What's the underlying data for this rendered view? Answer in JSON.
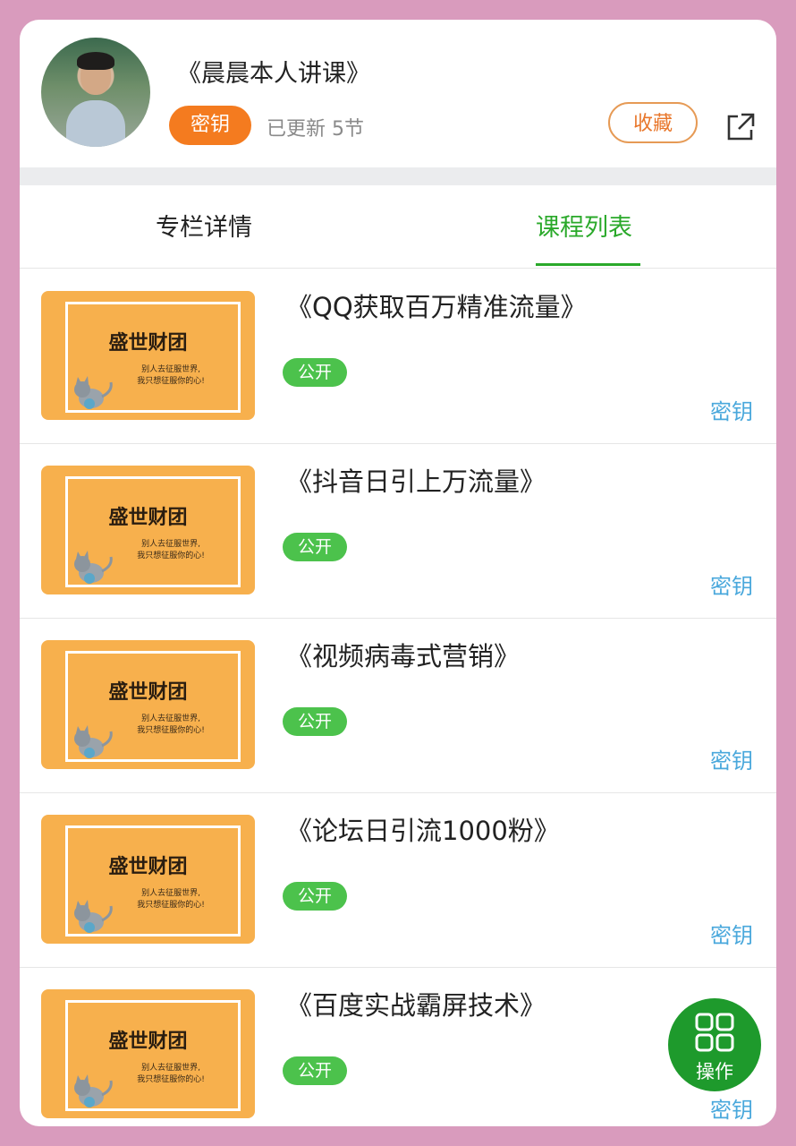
{
  "header": {
    "title": "《晨晨本人讲课》",
    "key_badge": "密钥",
    "updated": "已更新 5节",
    "favorite_button": "收藏",
    "share_icon": "share-external-icon"
  },
  "tabs": [
    {
      "label": "专栏详情",
      "active": false
    },
    {
      "label": "课程列表",
      "active": true
    }
  ],
  "thumbnail": {
    "brand": "盛世财团",
    "slogan_line1": "别人去征服世界,",
    "slogan_line2": "我只想征服你的心!"
  },
  "courses": [
    {
      "title": "《QQ获取百万精准流量》",
      "badge": "公开",
      "key": "密钥"
    },
    {
      "title": "《抖音日引上万流量》",
      "badge": "公开",
      "key": "密钥"
    },
    {
      "title": "《视频病毒式营销》",
      "badge": "公开",
      "key": "密钥"
    },
    {
      "title": "《论坛日引流1000粉》",
      "badge": "公开",
      "key": "密钥"
    },
    {
      "title": "《百度实战霸屏技术》",
      "badge": "公开",
      "key": "密钥"
    }
  ],
  "fab": {
    "label": "操作",
    "icon": "grid-icon"
  },
  "colors": {
    "background": "#d99bbd",
    "accent_green": "#2aa92a",
    "badge_orange": "#f47b1f",
    "key_blue": "#4aa8dc",
    "thumb_orange": "#f7b04d"
  }
}
